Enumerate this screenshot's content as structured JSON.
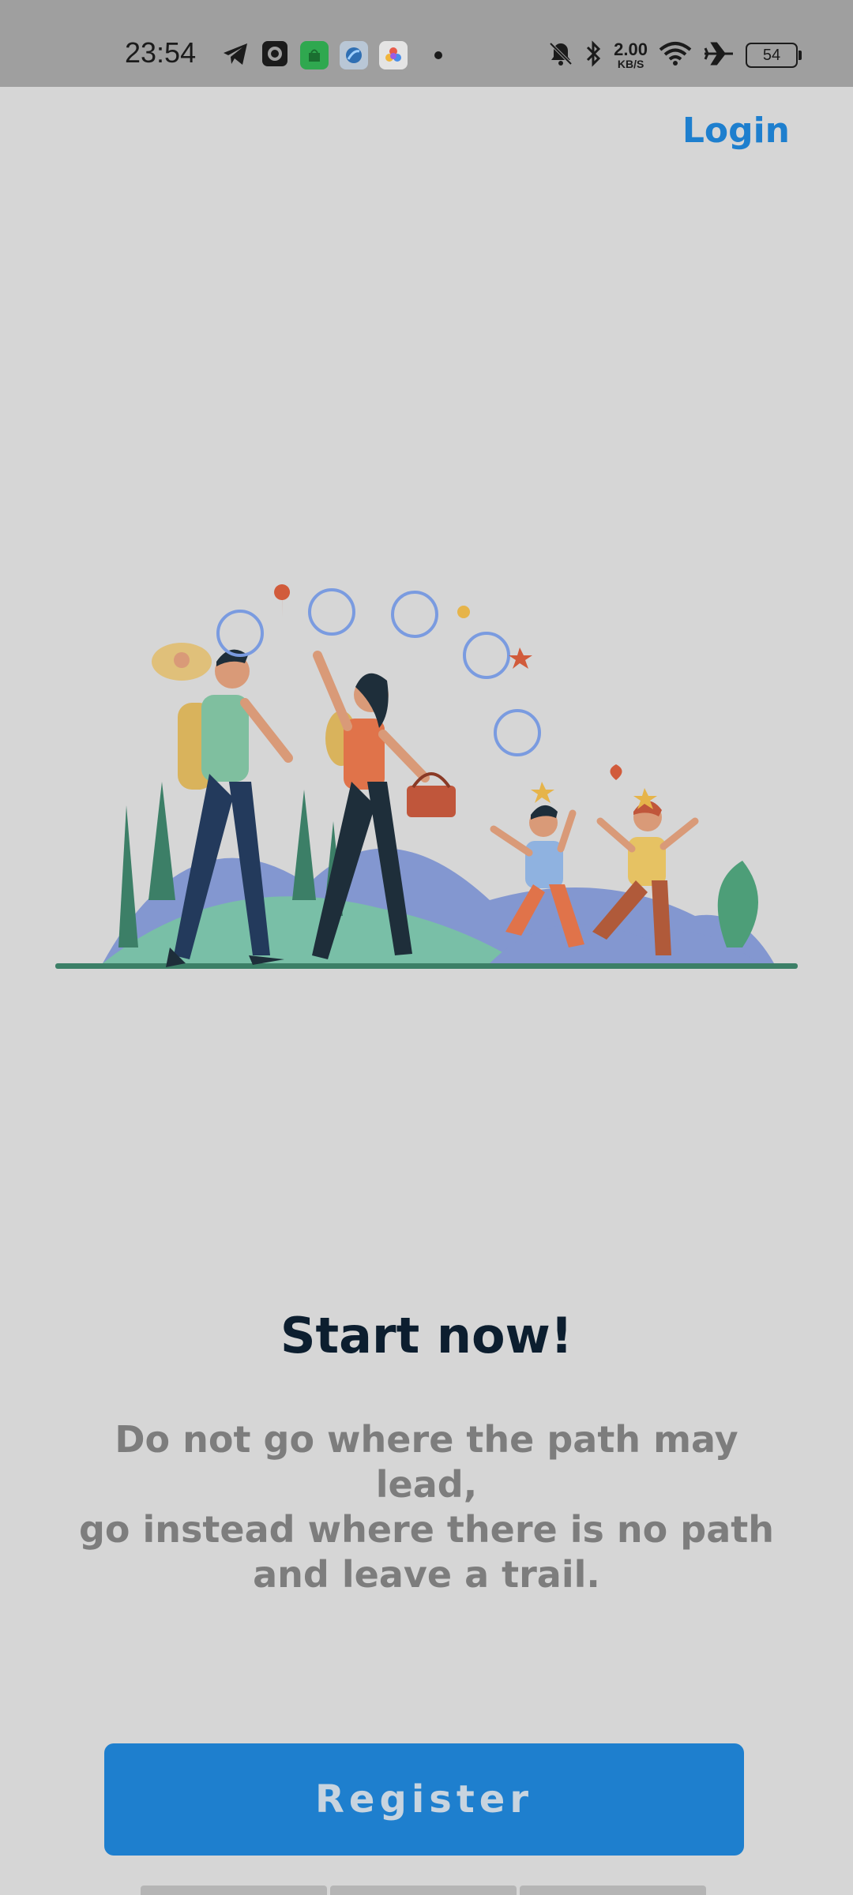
{
  "status_bar": {
    "time": "23:54",
    "net_speed_value": "2.00",
    "net_speed_unit": "KB/S",
    "battery": "54",
    "icons_left": [
      "telegram-icon",
      "camera-app-icon",
      "store-app-icon",
      "browser-app-icon",
      "gallery-app-icon",
      "notification-dot"
    ],
    "icons_right": [
      "mute-icon",
      "bluetooth-icon",
      "wifi-icon",
      "airplane-mode-icon",
      "battery-icon"
    ]
  },
  "header": {
    "login_label": "Login"
  },
  "onboarding": {
    "illustration_icon": "family-hiking-illustration",
    "headline": "Start now!",
    "quote_lines": [
      "Do not go where the path may lead,",
      "go instead where there is no path",
      "and leave a trail."
    ],
    "page_count": 3
  },
  "actions": {
    "register_label": "Register"
  },
  "colors": {
    "background": "#d6d6d6",
    "status_bar": "#9f9f9f",
    "accent": "#1e7fce",
    "headline": "#0c1e2f",
    "quote": "#7d7d7d"
  }
}
